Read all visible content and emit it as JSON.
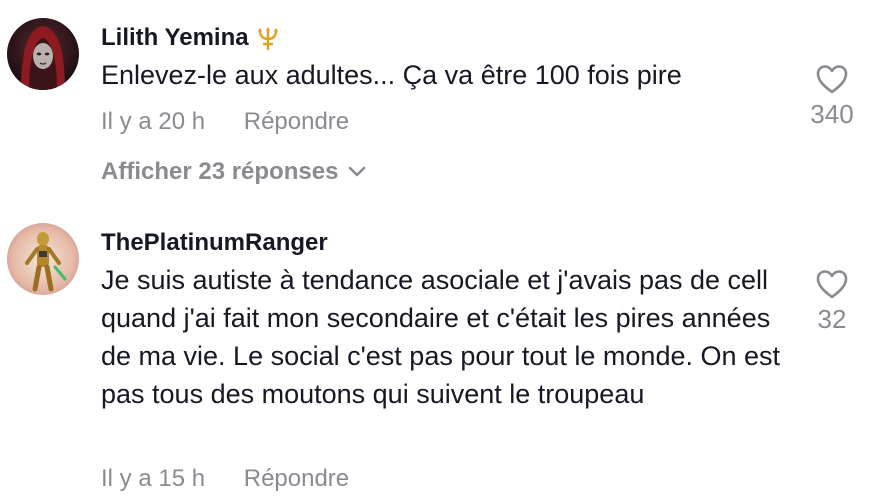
{
  "comments": [
    {
      "username": "Lilith Yemina",
      "badge_icon": "trident-icon",
      "text": "Enlevez-le aux adultes... Ça va être 100 fois pire",
      "time": "Il y a 20 h",
      "reply_label": "Répondre",
      "likes": "340",
      "view_replies": "Afficher 23 réponses"
    },
    {
      "username": "ThePlatinumRanger",
      "text": "Je suis autiste à tendance asociale et j'avais pas de cell quand j'ai fait mon secondaire et c'était les pires années de ma vie. Le social c'est pas pour tout le monde. On est pas tous des moutons qui suivent le troupeau",
      "time": "Il y a 15 h",
      "reply_label": "Répondre",
      "likes": "32"
    }
  ],
  "colors": {
    "text": "#161823",
    "muted": "#8a8b91",
    "badge": "#e0a21a"
  }
}
